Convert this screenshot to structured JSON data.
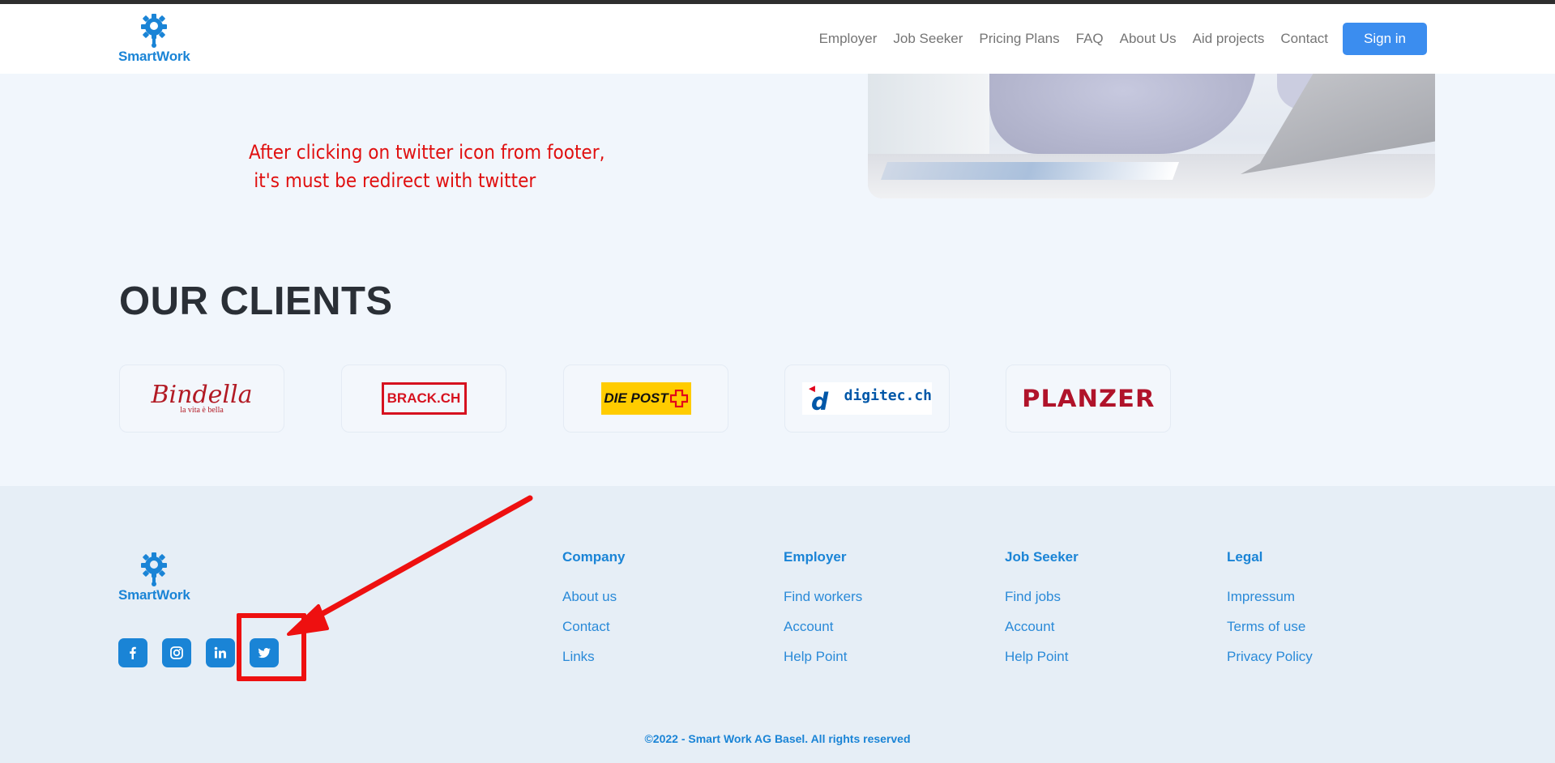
{
  "header": {
    "logo_text": "SmartWork",
    "nav": [
      "Employer",
      "Job Seeker",
      "Pricing Plans",
      "FAQ",
      "About Us",
      "Aid projects",
      "Contact"
    ],
    "signin_label": "Sign in"
  },
  "annotation": {
    "line1": "After clicking on twitter icon from footer,",
    "line2": "it's must be redirect with twitter"
  },
  "clients": {
    "title": "OUR CLIENTS",
    "logos": [
      {
        "name": "Bindella",
        "tagline": "la vita è bella",
        "color": "#b21a24"
      },
      {
        "name": "BRACK.CH",
        "color": "#d6121f"
      },
      {
        "name": "DIE POST",
        "color": "#ffcc00"
      },
      {
        "name": "digitec.ch",
        "color": "#0057a8"
      },
      {
        "name": "PLANZER",
        "color": "#b0132a"
      }
    ]
  },
  "footer": {
    "logo_text": "SmartWork",
    "social": [
      "facebook-icon",
      "instagram-icon",
      "linkedin-icon",
      "twitter-icon"
    ],
    "columns": [
      {
        "title": "Company",
        "links": [
          "About us",
          "Contact",
          "Links"
        ]
      },
      {
        "title": "Employer",
        "links": [
          "Find workers",
          "Account",
          "Help Point"
        ]
      },
      {
        "title": "Job Seeker",
        "links": [
          "Find jobs",
          "Account",
          "Help Point"
        ]
      },
      {
        "title": "Legal",
        "links": [
          "Impressum",
          "Terms of use",
          "Privacy Policy"
        ]
      }
    ],
    "copyright": "©2022 - Smart Work AG Basel. All rights reserved"
  },
  "colors": {
    "brand": "#1a84d6",
    "button": "#3b8def",
    "annotation": "#ee1010"
  }
}
